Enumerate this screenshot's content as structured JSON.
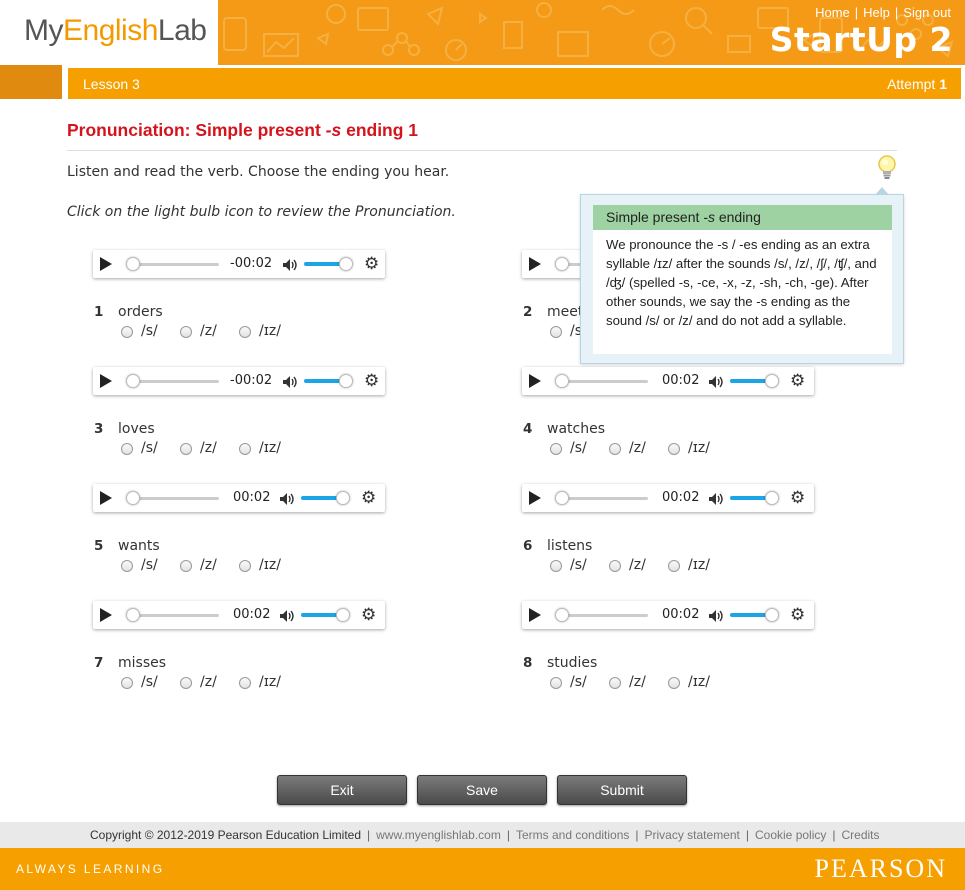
{
  "header": {
    "logo_prefix": "My",
    "logo_accent": "English",
    "logo_suffix": "Lab",
    "links": [
      "Home",
      "Help",
      "Sign out"
    ],
    "product": "StartUp 2"
  },
  "lesson_bar": {
    "lesson": "Lesson 3",
    "attempt_label": "Attempt",
    "attempt_value": "1"
  },
  "activity": {
    "title_prefix": "Pronunciation: Simple present ",
    "title_italic": "-s",
    "title_suffix": " ending 1",
    "instruction": "Listen and read the verb. Choose the ending you hear.",
    "hint": "Click on the light bulb icon to review the Pronunciation."
  },
  "tooltip": {
    "heading_prefix": "Simple present ",
    "heading_italic": "-s",
    "heading_suffix": " ending",
    "body": "We pronounce the -s / -es ending as an extra syllable /ɪz/ after the sounds /s/, /z/, /ʃ/, /ʧ/, and /ʤ/ (spelled -s, -ce, -x, -z, -sh, -ch, -ge). After other sounds, we say the -s ending as the sound /s/ or /z/ and do not add a syllable."
  },
  "players": [
    {
      "time": "-00:02"
    },
    {
      "time": ""
    },
    {
      "time": "-00:02"
    },
    {
      "time": "00:02"
    },
    {
      "time": "00:02"
    },
    {
      "time": "00:02"
    },
    {
      "time": "00:02"
    },
    {
      "time": "00:02"
    }
  ],
  "options": [
    "/s/",
    "/z/",
    "/ɪz/"
  ],
  "items": [
    {
      "num": "1",
      "word": "orders"
    },
    {
      "num": "2",
      "word": "meets"
    },
    {
      "num": "3",
      "word": "loves"
    },
    {
      "num": "4",
      "word": "watches"
    },
    {
      "num": "5",
      "word": "wants"
    },
    {
      "num": "6",
      "word": "listens"
    },
    {
      "num": "7",
      "word": "misses"
    },
    {
      "num": "8",
      "word": "studies"
    }
  ],
  "buttons": {
    "exit": "Exit",
    "save": "Save",
    "submit": "Submit"
  },
  "footer": {
    "copyright": "Copyright © 2012-2019 Pearson Education Limited",
    "links": [
      "www.myenglishlab.com",
      "Terms and conditions",
      "Privacy statement",
      "Cookie policy",
      "Credits"
    ],
    "tagline": "ALWAYS LEARNING",
    "brand": "PEARSON"
  },
  "colors": {
    "accent": "#f59f00",
    "title": "#d4141c",
    "volume": "#1aa5e6",
    "tip_head": "#9ed2a2"
  }
}
